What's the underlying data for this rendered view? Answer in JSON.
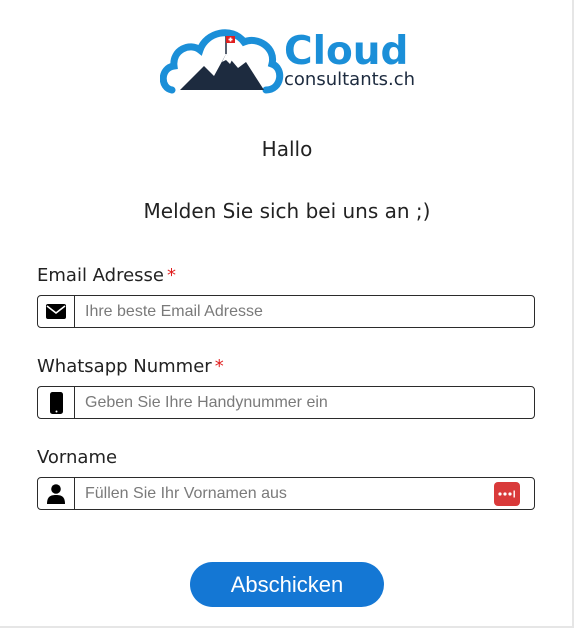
{
  "brand": {
    "name_main": "Cloud",
    "name_sub": "consultants.ch",
    "color_primary": "#1b8fd8",
    "color_dark": "#1d2b3f"
  },
  "greeting": "Hallo",
  "subtitle": "Melden Sie sich bei uns an ;)",
  "form": {
    "email": {
      "label": "Email Adresse",
      "required_mark": "*",
      "placeholder": "Ihre beste Email Adresse",
      "icon": "envelope-icon"
    },
    "whatsapp": {
      "label": "Whatsapp Nummer",
      "required_mark": "*",
      "placeholder": "Geben Sie Ihre Handynummer ein",
      "icon": "phone-icon"
    },
    "firstname": {
      "label": "Vorname",
      "placeholder": "Füllen Sie Ihr Vornamen aus",
      "icon": "user-icon",
      "trailing_icon": "password-manager-icon"
    },
    "submit_label": "Abschicken",
    "submit_color": "#1477d4"
  }
}
